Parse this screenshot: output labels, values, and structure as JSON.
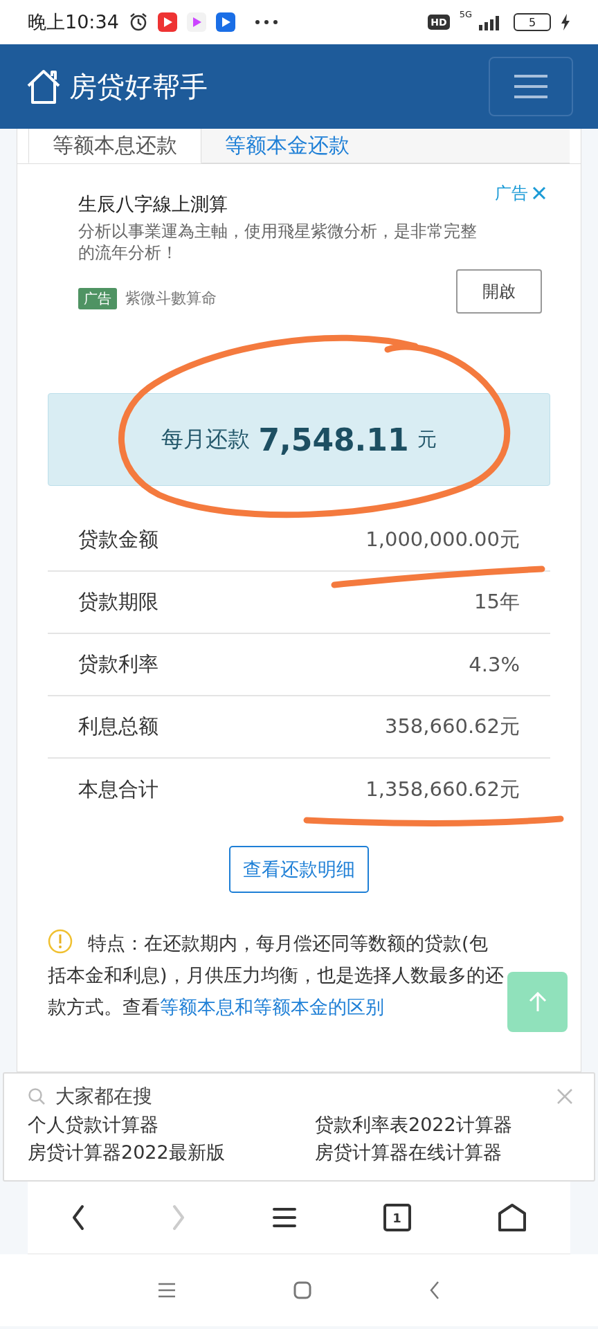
{
  "status_bar": {
    "time": "晚上10:34",
    "hd": "HD",
    "network": "5G",
    "battery": "5"
  },
  "header": {
    "title": "房贷好帮手"
  },
  "tabs": [
    {
      "label": "等额本息还款",
      "selected": true
    },
    {
      "label": "等额本金还款",
      "selected": false
    }
  ],
  "ad": {
    "corner_label": "广告",
    "title": "生辰八字線上測算",
    "description": "分析以事業運為主軸，使用飛星紫微分析，是非常完整的流年分析！",
    "badge": "广告",
    "advertiser": "紫微斗數算命",
    "button": "開啟"
  },
  "monthly": {
    "label": "每月还款",
    "amount": "7,548.11",
    "unit": "元"
  },
  "summary": [
    {
      "label": "贷款金额",
      "value": "1,000,000.00元"
    },
    {
      "label": "贷款期限",
      "value": "15年"
    },
    {
      "label": "贷款利率",
      "value": "4.3%"
    },
    {
      "label": "利息总额",
      "value": "358,660.62元"
    },
    {
      "label": "本息合计",
      "value": "1,358,660.62元"
    }
  ],
  "detail_button": "查看还款明细",
  "note": {
    "text": "特点：在还款期内，每月偿还同等数额的贷款(包括本金和利息)，月供压力均衡，也是选择人数最多的还款方式。查看",
    "link": "等额本息和等额本金的区别"
  },
  "hot_search": {
    "title": "大家都在搜",
    "items": [
      "个人贷款计算器",
      "贷款利率表2022计算器",
      "房贷计算器2022最新版",
      "房贷计算器在线计算器"
    ]
  },
  "browser_toolbar": {
    "tab_count": "1"
  }
}
